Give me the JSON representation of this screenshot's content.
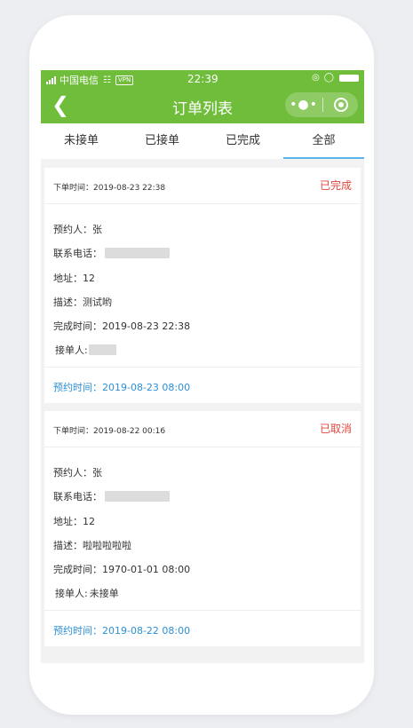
{
  "status_bar": {
    "carrier": "中国电信",
    "vpn": "VPN",
    "time": "22:39"
  },
  "navbar": {
    "title": "订单列表",
    "back_icon": "chevron-left-icon",
    "more_icon": "more-dots-icon",
    "close_icon": "target-circle-icon"
  },
  "tabs": [
    {
      "label": "未接单",
      "active": false
    },
    {
      "label": "已接单",
      "active": false
    },
    {
      "label": "已完成",
      "active": false
    },
    {
      "label": "全部",
      "active": true
    }
  ],
  "colors": {
    "brand_green": "#6fbd3a",
    "status_red": "#e2463e",
    "link_blue": "#2d8fd5",
    "tab_underline": "#5bb5e6"
  },
  "orders": [
    {
      "order_time": "下单时间：2019-08-23 22:38",
      "status": "已完成",
      "booker": "预约人：张",
      "phone_label": "联系电话：",
      "address": "地址：12",
      "description": "描述：测试哟",
      "finish_time": "完成时间：2019-08-23 22:38",
      "receiver_label": "接单人:",
      "receiver_value": "",
      "appointment": "预约时间：2019-08-23 08:00"
    },
    {
      "order_time": "下单时间：2019-08-22 00:16",
      "status": "已取消",
      "booker": "预约人：张",
      "phone_label": "联系电话：",
      "address": "地址：12",
      "description": "描述：啦啦啦啦啦",
      "finish_time": "完成时间：1970-01-01 08:00",
      "receiver_label": "接单人:",
      "receiver_value": "未接单",
      "appointment": "预约时间：2019-08-22 08:00"
    }
  ]
}
